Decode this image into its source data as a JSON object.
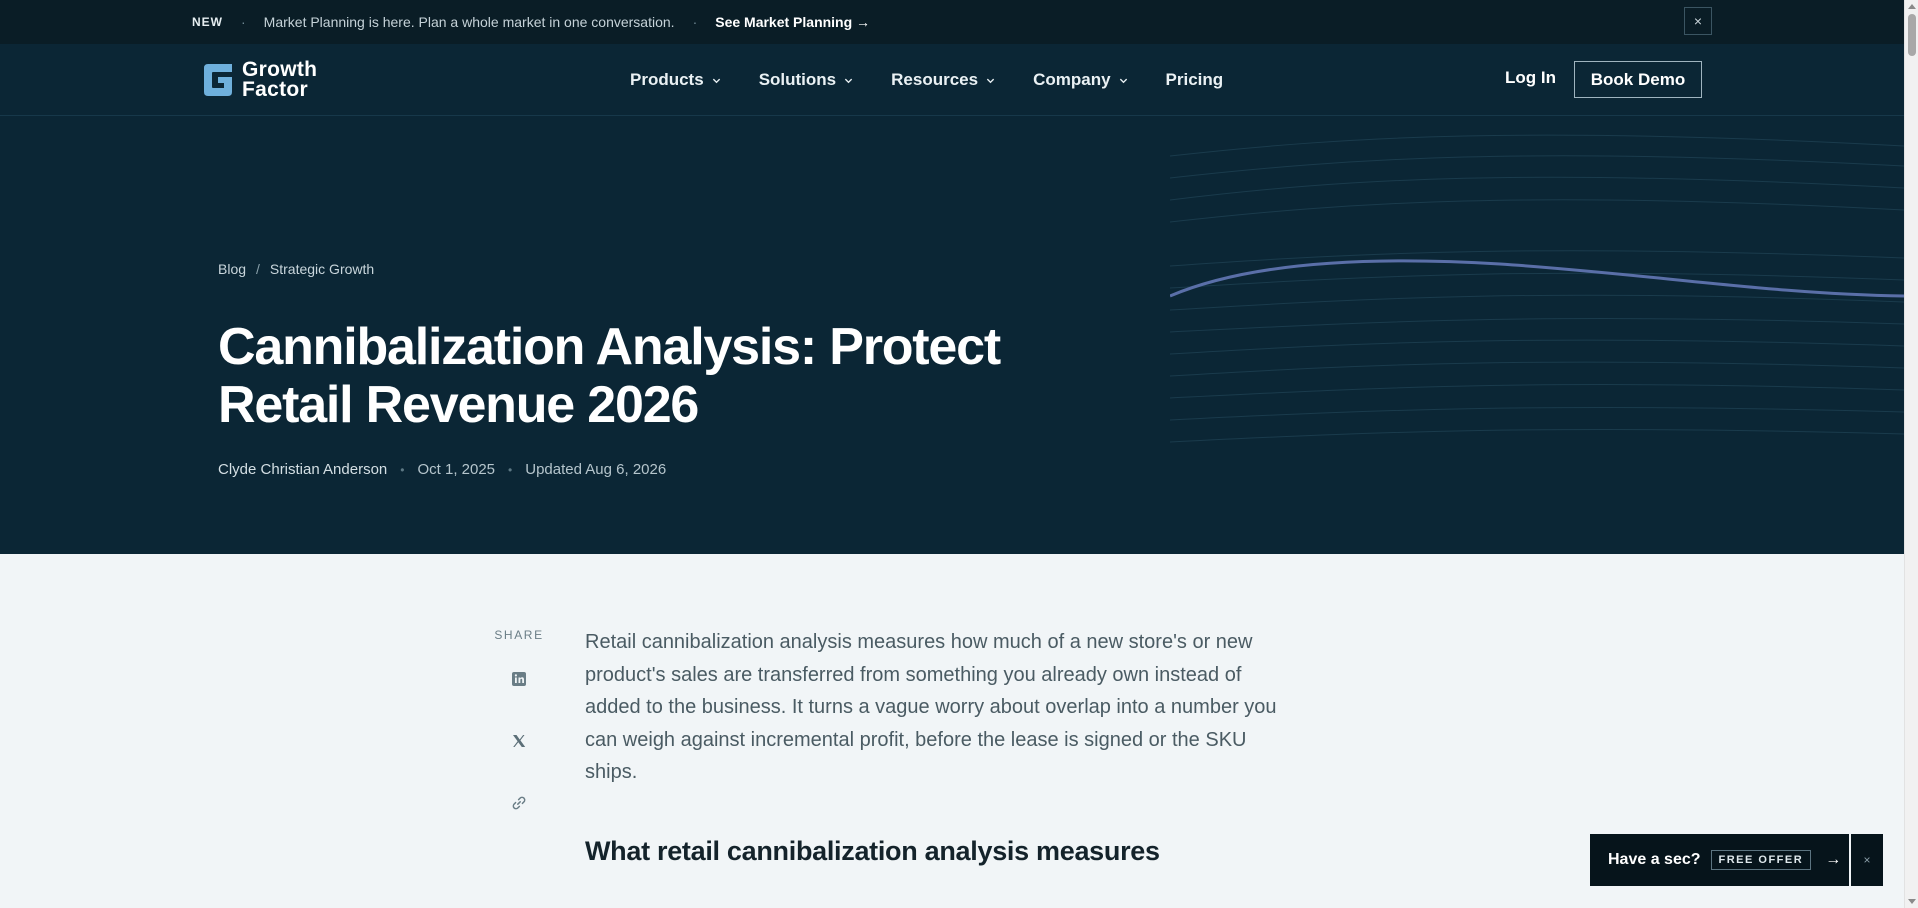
{
  "announcement": {
    "tag": "NEW",
    "message": "Market Planning is here. Plan a whole market in one conversation.",
    "cta": "See Market Planning →",
    "close": "×"
  },
  "brand": {
    "line1": "Growth",
    "line2": "Factor"
  },
  "nav": {
    "items": [
      {
        "label": "Products",
        "has_menu": true
      },
      {
        "label": "Solutions",
        "has_menu": true
      },
      {
        "label": "Resources",
        "has_menu": true
      },
      {
        "label": "Company",
        "has_menu": true
      },
      {
        "label": "Pricing",
        "has_menu": false
      }
    ],
    "login": "Log In",
    "demo": "Book Demo"
  },
  "breadcrumb": {
    "root": "Blog",
    "sep": "/",
    "current": "Strategic Growth"
  },
  "post": {
    "title": "Cannibalization Analysis: Protect Retail Revenue 2026",
    "author": "Clyde Christian Anderson",
    "date": "Oct 1, 2025",
    "updated": "Updated Aug 6, 2026",
    "lead": "Retail cannibalization analysis measures how much of a new store's or new product's sales are transferred from something you already own instead of added to the business. It turns a vague worry about overlap into a number you can weigh against incremental profit, before the lease is signed or the SKU ships.",
    "heading": "What retail cannibalization analysis measures"
  },
  "share": {
    "label": "SHARE",
    "icons": [
      "linkedin-icon",
      "x-icon",
      "link-icon"
    ]
  },
  "offer": {
    "text": "Have a sec?",
    "badge": "FREE OFFER",
    "arrow": "→",
    "close": "×"
  },
  "colors": {
    "announce_bg": "#0a1d26",
    "hero_bg": "#0b2635",
    "page_bg": "#f1f5f7",
    "logo_blue": "#6fb0dc",
    "wave_accent": "#5a6fa8"
  }
}
